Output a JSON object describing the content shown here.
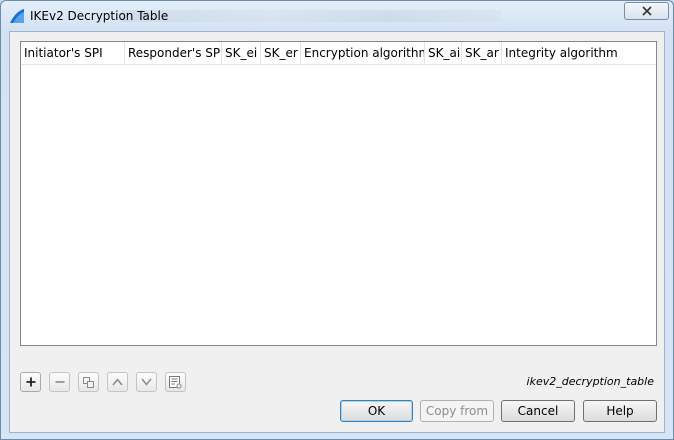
{
  "window": {
    "title": "IKEv2 Decryption Table"
  },
  "table": {
    "columns": [
      "Initiator's SPI",
      "Responder's SPI",
      "SK_ei",
      "SK_er",
      "Encryption algorithm",
      "SK_ai",
      "SK_ar",
      "Integrity algorithm"
    ],
    "rows": []
  },
  "toolbar": {
    "add_icon": "plus-icon",
    "remove_icon": "minus-icon",
    "copy_icon": "copy-icon",
    "move_up_icon": "chevron-up-icon",
    "move_down_icon": "chevron-down-icon",
    "clear_icon": "clear-list-icon"
  },
  "filename": "ikev2_decryption_table",
  "buttons": {
    "ok": "OK",
    "copy_from": "Copy from",
    "cancel": "Cancel",
    "help": "Help"
  }
}
